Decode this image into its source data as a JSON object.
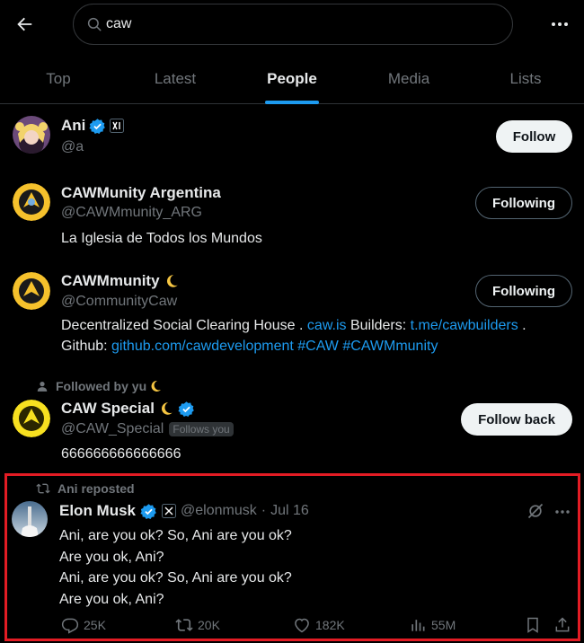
{
  "search": {
    "query": "caw"
  },
  "tabs": [
    {
      "label": "Top"
    },
    {
      "label": "Latest"
    },
    {
      "label": "People"
    },
    {
      "label": "Media"
    },
    {
      "label": "Lists"
    }
  ],
  "users": [
    {
      "name": "Ani",
      "handle": "@a",
      "button": "Follow"
    },
    {
      "name": "CAWMunity Argentina",
      "handle": "@CAWMmunity_ARG",
      "button": "Following",
      "bio": "La Iglesia de Todos los Mundos"
    },
    {
      "name": "CAWMmunity",
      "handle": "@CommunityCaw",
      "button": "Following",
      "bio_text1": "Decentralized Social Clearing House . ",
      "bio_link1": "caw.is",
      "bio_text2": " Builders: ",
      "bio_link2": "t.me/cawbuilders",
      "bio_text3": " .",
      "bio_text4": "Github: ",
      "bio_link3": "github.com/cawdevelopment",
      "bio_link4": "#CAW",
      "bio_link5": "#CAWMmunity"
    },
    {
      "social": "Followed by yu",
      "name": "CAW Special",
      "handle": "@CAW_Special",
      "follows_you": "Follows you",
      "button": "Follow back",
      "bio": "666666666666666"
    }
  ],
  "post": {
    "repost_label": "Ani reposted",
    "author": "Elon Musk",
    "handle": "@elonmusk",
    "separator": "·",
    "date": "Jul 16",
    "lines": [
      "Ani, are you ok? So, Ani are you ok?",
      "Are you ok, Ani?",
      "Ani, are you ok? So, Ani are you ok?",
      "Are you ok, Ani?"
    ],
    "stats": {
      "replies": "25K",
      "reposts": "20K",
      "likes": "182K",
      "views": "55M"
    }
  },
  "colors": {
    "accent": "#1d9bf0",
    "verified": "#1d9bf0",
    "highlight": "#e31c24"
  }
}
